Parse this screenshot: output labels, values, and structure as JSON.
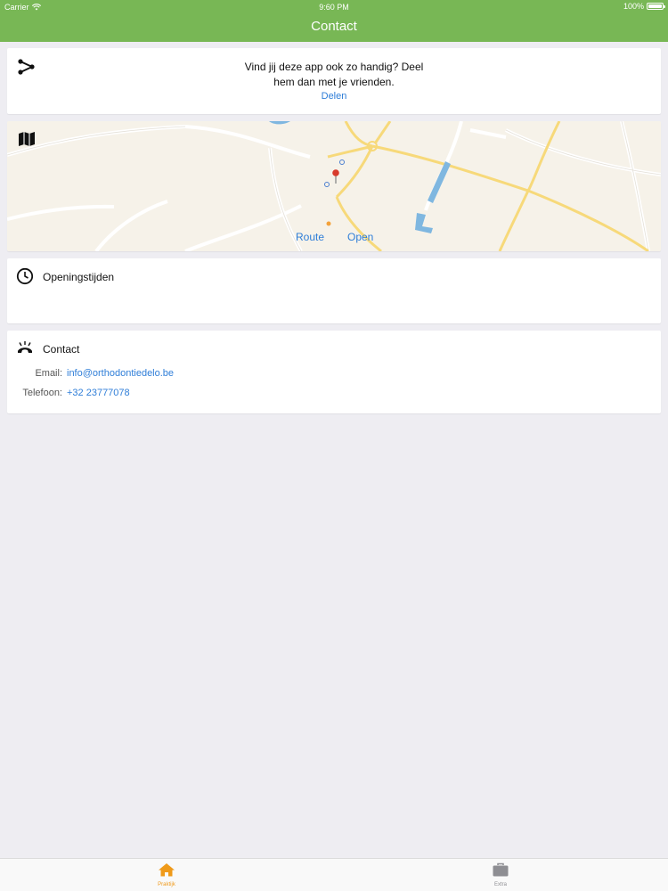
{
  "status_bar": {
    "carrier": "Carrier",
    "time": "9:60 PM",
    "battery": "100%"
  },
  "nav": {
    "title": "Contact"
  },
  "share": {
    "message_line1": "Vind jij deze app ook zo handig? Deel",
    "message_line2": "hem dan met je vrienden.",
    "button_label": "Delen"
  },
  "map": {
    "route_label": "Route",
    "open_label": "Open"
  },
  "hours": {
    "title": "Openingstijden"
  },
  "contact": {
    "title": "Contact",
    "email_label": "Email:",
    "email_value": "info@orthodontiedelo.be",
    "phone_label": "Telefoon:",
    "phone_value": "+32 23777078"
  },
  "tabbar": {
    "tabs": [
      {
        "label": "Praktijk",
        "icon": "home-icon",
        "active": true
      },
      {
        "label": "Extra",
        "icon": "briefcase-icon",
        "active": false
      }
    ]
  },
  "colors": {
    "header": "#78b755",
    "link": "#2f7ed8",
    "active_tab": "#ef9a1a",
    "inactive_tab": "#8e8e93"
  }
}
